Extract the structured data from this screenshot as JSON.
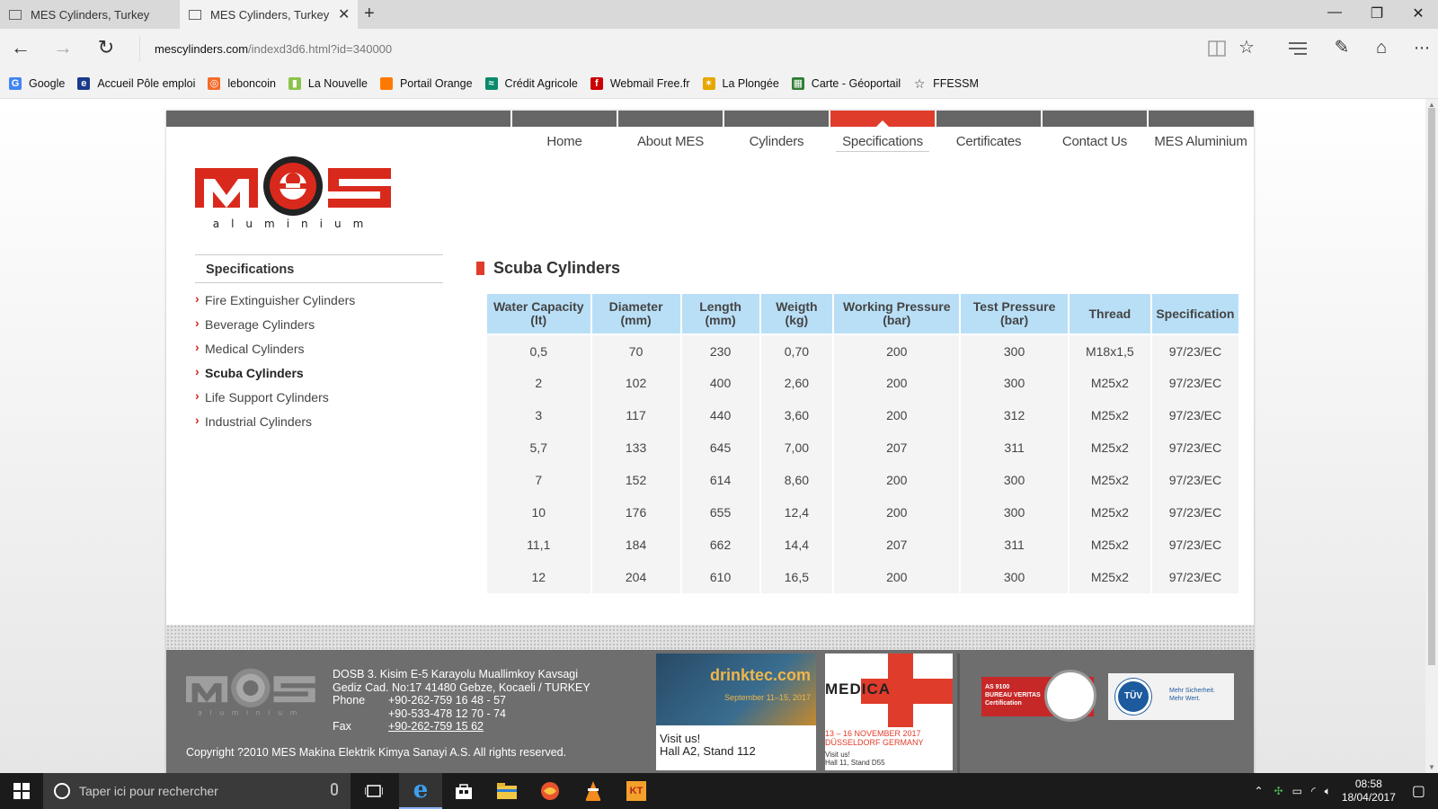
{
  "browser": {
    "tabs": [
      {
        "title": "MES Cylinders, Turkey"
      },
      {
        "title": "MES Cylinders, Turkey -"
      }
    ],
    "new_tab": "+",
    "window_controls": {
      "minimize": "—",
      "restore": "❐",
      "close": "✕"
    },
    "address": {
      "host": "mescylinders.com",
      "path": "/indexd3d6.html?id=340000"
    },
    "favorites": [
      {
        "label": "Google",
        "icon": "google-icon",
        "color": "#4285f4",
        "glyph": "G"
      },
      {
        "label": "Accueil Pôle emploi",
        "icon": "pole-emploi-icon",
        "color": "#1b3a8c",
        "glyph": "e"
      },
      {
        "label": "leboncoin",
        "icon": "leboncoin-icon",
        "color": "#f56b2a",
        "glyph": "◎"
      },
      {
        "label": "La Nouvelle",
        "icon": "la-nouvelle-icon",
        "color": "#8bc34a",
        "glyph": "▮"
      },
      {
        "label": "Portail Orange",
        "icon": "orange-icon",
        "color": "#ff7900",
        "glyph": " "
      },
      {
        "label": "Crédit Agricole",
        "icon": "credit-agricole-icon",
        "color": "#0a8a6a",
        "glyph": "≈"
      },
      {
        "label": "Webmail Free.fr",
        "icon": "free-icon",
        "color": "#cc0000",
        "glyph": "f"
      },
      {
        "label": "La Plongée",
        "icon": "la-plongee-icon",
        "color": "#e6a700",
        "glyph": "✶"
      },
      {
        "label": "Carte - Géoportail",
        "icon": "geoportail-icon",
        "color": "#2e7d32",
        "glyph": "▦"
      },
      {
        "label": "FFESSM",
        "icon": "star-icon",
        "color": "#f2f2f2",
        "glyph": "☆"
      }
    ]
  },
  "site": {
    "menu": [
      {
        "label": "Home",
        "active": false
      },
      {
        "label": "About MES",
        "active": false
      },
      {
        "label": "Cylinders",
        "active": false
      },
      {
        "label": "Specifications",
        "active": true
      },
      {
        "label": "Certificates",
        "active": false
      },
      {
        "label": "Contact Us",
        "active": false
      },
      {
        "label": "MES Aluminium",
        "active": false
      }
    ],
    "logo": {
      "word": "MeS",
      "tagline": "aluminium"
    },
    "sidebar": {
      "title": "Specifications",
      "items": [
        {
          "label": "Fire Extinguisher Cylinders",
          "current": false
        },
        {
          "label": "Beverage Cylinders",
          "current": false
        },
        {
          "label": "Medical Cylinders",
          "current": false
        },
        {
          "label": "Scuba Cylinders",
          "current": true
        },
        {
          "label": "Life Support Cylinders",
          "current": false
        },
        {
          "label": "Industrial Cylinders",
          "current": false
        }
      ]
    },
    "content_title": "Scuba Cylinders",
    "table": {
      "headers": [
        [
          "Water Capacity",
          "(lt)"
        ],
        [
          "Diameter",
          "(mm)"
        ],
        [
          "Length",
          "(mm)"
        ],
        [
          "Weigth",
          "(kg)"
        ],
        [
          "Working Pressure",
          "(bar)"
        ],
        [
          "Test Pressure",
          "(bar)"
        ],
        [
          "Thread",
          ""
        ],
        [
          "Specification",
          ""
        ]
      ],
      "rows": [
        [
          "0,5",
          "70",
          "230",
          "0,70",
          "200",
          "300",
          "M18x1,5",
          "97/23/EC"
        ],
        [
          "2",
          "102",
          "400",
          "2,60",
          "200",
          "300",
          "M25x2",
          "97/23/EC"
        ],
        [
          "3",
          "117",
          "440",
          "3,60",
          "200",
          "312",
          "M25x2",
          "97/23/EC"
        ],
        [
          "5,7",
          "133",
          "645",
          "7,00",
          "207",
          "311",
          "M25x2",
          "97/23/EC"
        ],
        [
          "7",
          "152",
          "614",
          "8,60",
          "200",
          "300",
          "M25x2",
          "97/23/EC"
        ],
        [
          "10",
          "176",
          "655",
          "12,4",
          "200",
          "300",
          "M25x2",
          "97/23/EC"
        ],
        [
          "11,1",
          "184",
          "662",
          "14,4",
          "207",
          "311",
          "M25x2",
          "97/23/EC"
        ],
        [
          "12",
          "204",
          "610",
          "16,5",
          "200",
          "300",
          "M25x2",
          "97/23/EC"
        ]
      ]
    },
    "footer": {
      "address_line1": "DOSB 3. Kisim E-5 Karayolu Muallimkoy Kavsagi",
      "address_line2": "Gediz Cad. No:17 41480 Gebze, Kocaeli / TURKEY",
      "phone_label": "Phone",
      "phone1": "+90-262-759 16 48 - 57",
      "phone2": "+90-533-478 12 70 - 74",
      "fax_label": "Fax",
      "fax": "+90-262-759 15 62",
      "copyright": "Copyright ?2010 MES Makina Elektrik Kimya Sanayi A.S. All rights reserved.",
      "ads": {
        "drinktec": {
          "name": "drinktec.com",
          "date": "September 11–15, 2017",
          "visit": "Visit us!",
          "stand": "Hall A2, Stand 112"
        },
        "medica": {
          "name": "MEDICA",
          "date": "13 – 16 NOVEMBER 2017",
          "city": "DÜSSELDORF GERMANY",
          "visit": "Visit us!",
          "stand": "Hall 11, Stand D55"
        }
      },
      "certs": {
        "bv_code": "AS 9100",
        "bv_name": "BUREAU VERITAS",
        "bv_sub": "Certification",
        "tuv_name": "TÜV",
        "tuv_tag1": "Mehr Sicherheit.",
        "tuv_tag2": "Mehr Wert."
      }
    }
  },
  "taskbar": {
    "search_placeholder": "Taper ici pour rechercher",
    "time": "08:58",
    "date": "18/04/2017"
  },
  "colors": {
    "accent_red": "#e03c2b",
    "table_header": "#b9dff7",
    "footer": "#6e6e6e"
  }
}
